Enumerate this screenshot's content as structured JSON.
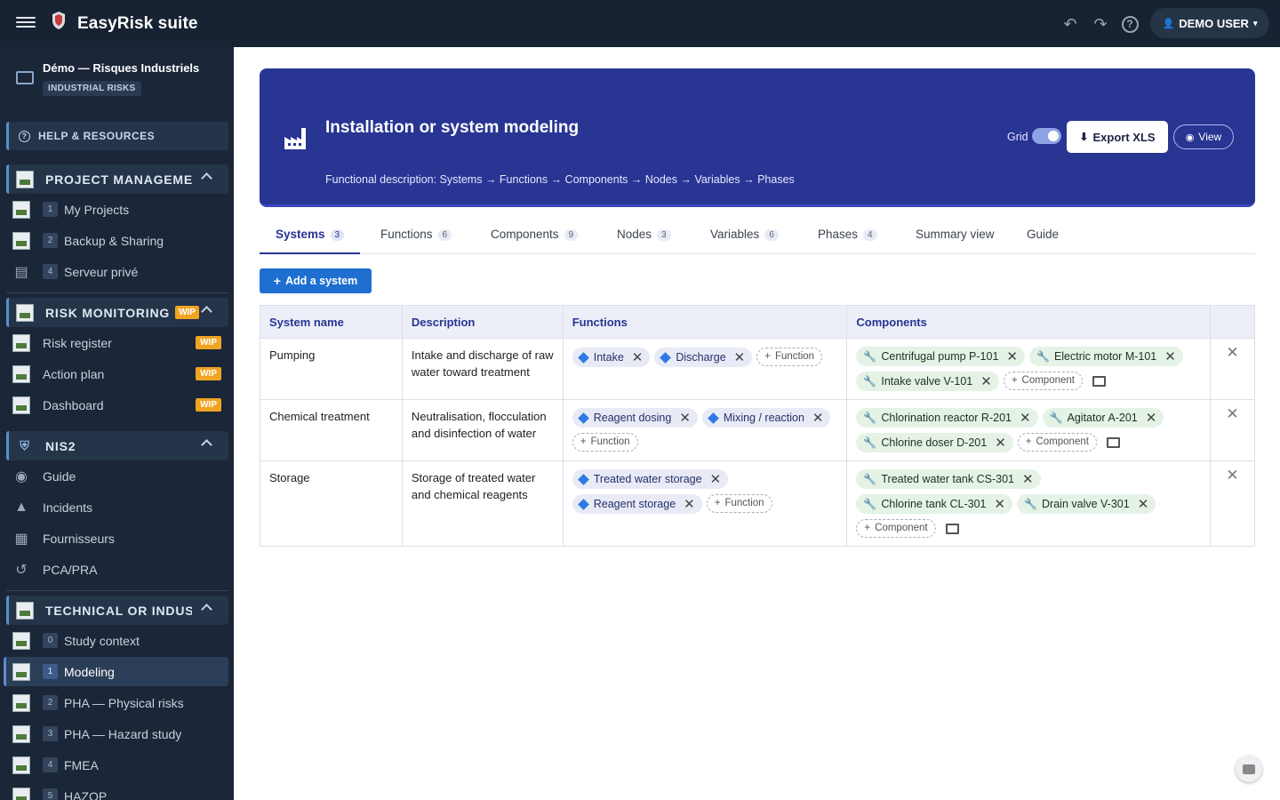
{
  "app": {
    "brand": "EasyRisk suite",
    "user": "DEMO USER"
  },
  "project": {
    "title": "Démo — Risques Industriels",
    "badge": "INDUSTRIAL RISKS"
  },
  "help_label": "HELP & RESOURCES",
  "sections": {
    "pm": {
      "label": "PROJECT MANAGEMEN",
      "items": [
        {
          "num": "1",
          "label": "My Projects"
        },
        {
          "num": "2",
          "label": "Backup & Sharing"
        },
        {
          "num": "4",
          "label": "Serveur privé"
        }
      ]
    },
    "rm": {
      "label": "RISK MONITORING",
      "wip": "WIP",
      "items": [
        {
          "label": "Risk register",
          "wip": "WIP"
        },
        {
          "label": "Action plan",
          "wip": "WIP"
        },
        {
          "label": "Dashboard",
          "wip": "WIP"
        }
      ]
    },
    "nis2": {
      "label": "NIS2",
      "items": [
        {
          "label": "Guide"
        },
        {
          "label": "Incidents"
        },
        {
          "label": "Fournisseurs"
        },
        {
          "label": "PCA/PRA"
        }
      ]
    },
    "tech": {
      "label": "TECHNICAL OR INDUSTI",
      "items": [
        {
          "num": "0",
          "label": "Study context"
        },
        {
          "num": "1",
          "label": "Modeling"
        },
        {
          "num": "2",
          "label": "PHA — Physical risks"
        },
        {
          "num": "3",
          "label": "PHA — Hazard study"
        },
        {
          "num": "4",
          "label": "FMEA"
        },
        {
          "num": "5",
          "label": "HAZOP"
        }
      ]
    }
  },
  "hero": {
    "title": "Installation or system modeling",
    "subtitle": "Functional description: Systems → Functions → Components → Nodes → Variables → Phases",
    "grid_label": "Grid",
    "export_label": "Export XLS",
    "view_label": "View"
  },
  "tabs": [
    {
      "label": "Systems",
      "count": "3"
    },
    {
      "label": "Functions",
      "count": "6"
    },
    {
      "label": "Components",
      "count": "9"
    },
    {
      "label": "Nodes",
      "count": "3"
    },
    {
      "label": "Variables",
      "count": "6"
    },
    {
      "label": "Phases",
      "count": "4"
    },
    {
      "label": "Summary view",
      "count": ""
    },
    {
      "label": "Guide",
      "count": ""
    }
  ],
  "add_system_label": "Add a system",
  "table": {
    "headers": [
      "System name",
      "Description",
      "Functions",
      "Components"
    ],
    "add_function": "Function",
    "add_component": "Component",
    "rows": [
      {
        "name": "Pumping",
        "description": "Intake and discharge of raw water toward treatment",
        "functions": [
          "Intake",
          "Discharge"
        ],
        "components": [
          "Centrifugal pump P-101",
          "Electric motor M-101",
          "Intake valve V-101"
        ]
      },
      {
        "name": "Chemical treatment",
        "description": "Neutralisation, flocculation and disinfection of water",
        "functions": [
          "Reagent dosing",
          "Mixing / reaction"
        ],
        "components": [
          "Chlorination reactor R-201",
          "Agitator A-201",
          "Chlorine doser D-201"
        ]
      },
      {
        "name": "Storage",
        "description": "Storage of treated water and chemical reagents",
        "functions": [
          "Treated water storage",
          "Reagent storage"
        ],
        "components": [
          "Treated water tank CS-301",
          "Chlorine tank CL-301",
          "Drain valve V-301"
        ]
      }
    ]
  }
}
